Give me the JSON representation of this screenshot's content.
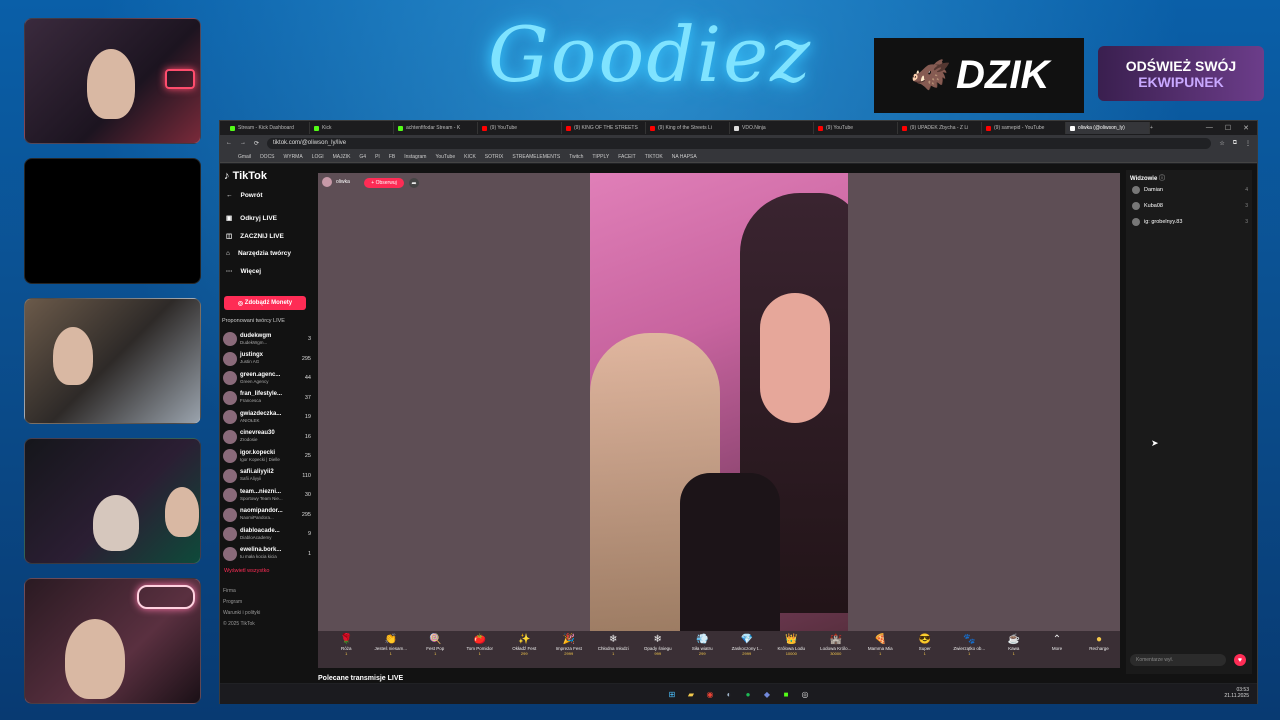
{
  "overlay": {
    "logo": "Goodiez",
    "sponsor_brand": "DZIK",
    "sponsor_promo_line1": "ODŚWIEŻ SWÓJ",
    "sponsor_promo_line2": "EKWIPUNEK"
  },
  "browser": {
    "tabs": [
      {
        "label": "Stream - Kick Dashboard",
        "color": "#53fc18"
      },
      {
        "label": "Kick",
        "color": "#53fc18"
      },
      {
        "label": "achtenfifodar Stream - K",
        "color": "#53fc18"
      },
      {
        "label": "(9) YouTube",
        "color": "#ff0000"
      },
      {
        "label": "(9) KING OF THE STREETS",
        "color": "#ff0000"
      },
      {
        "label": "(9) King of the Streets Li",
        "color": "#ff0000"
      },
      {
        "label": "VDO.Ninja",
        "color": "#dddddd"
      },
      {
        "label": "(9) YouTube",
        "color": "#ff0000"
      },
      {
        "label": "(9) UPADEK Zbycha - Z Li",
        "color": "#ff0000"
      },
      {
        "label": "(9) samepid - YouTube",
        "color": "#ff0000"
      },
      {
        "label": "oliwka (@oliwson_ly)",
        "color": "#ffffff",
        "active": true
      }
    ],
    "url": "tiktok.com/@oliwson_ly/live",
    "bookmarks": [
      "Gmail",
      "DOCS",
      "WYRMA",
      "LOGI",
      "MAJZIK",
      "G4",
      "PI",
      "FB",
      "Instagram",
      "YouTube",
      "KICK",
      "SOTRIX",
      "STREAMELEMENTS",
      "Twitch",
      "TIPPLY",
      "FACEIT",
      "TIKTOK",
      "NA HAPSA"
    ]
  },
  "tiktok": {
    "logo": "TikTok",
    "nav": {
      "back": "Powrót",
      "discover_live": "Odkryj LIVE",
      "start_live": "ZACZNIJ LIVE",
      "creator_tools": "Narzędzia twórcy",
      "more": "Więcej",
      "get_coins": "Zdobądź Monety"
    },
    "suggested_title": "Proponowani twórcy LIVE",
    "creators": [
      {
        "name": "dudekwgm",
        "sub": "DudekWgm...",
        "count": "3"
      },
      {
        "name": "justingx",
        "sub": "Justin AG",
        "count": "295"
      },
      {
        "name": "green.agenc...",
        "sub": "Green Agency",
        "count": "44"
      },
      {
        "name": "fran_lifestyle...",
        "sub": "Francesca",
        "count": "37"
      },
      {
        "name": "gwiazdeczka...",
        "sub": "ANIOŁEK",
        "count": "19"
      },
      {
        "name": "cinevreau30",
        "sub": "Zrodosie",
        "count": "16"
      },
      {
        "name": "igor.kopecki",
        "sub": "Igor Kopecki | Dielle",
        "count": "25"
      },
      {
        "name": "safii.aliyyii2",
        "sub": "Safii Aliyyii",
        "count": "110"
      },
      {
        "name": "team...niezni...",
        "sub": "Sportowy Team Nie...",
        "count": "30"
      },
      {
        "name": "naomipandor...",
        "sub": "NaomiPandora...",
        "count": "295"
      },
      {
        "name": "diabloacade...",
        "sub": "DiabloAcademy",
        "count": "9"
      },
      {
        "name": "ewelina.bork...",
        "sub": "tu mała kocia kicia",
        "count": "1"
      }
    ],
    "show_all": "Wyświetl wszystko",
    "footer": [
      "Firma",
      "Program",
      "Warunki i polityki",
      "© 2025 TikTok"
    ],
    "streamer": "oliwka",
    "follow": "+ Obserwuj",
    "gifts": [
      {
        "name": "Róża",
        "price": "1",
        "icon": "🌹"
      },
      {
        "name": "Jesteś niesam...",
        "price": "1",
        "icon": "👏"
      },
      {
        "name": "Fest Pop",
        "price": "1",
        "icon": "🍭"
      },
      {
        "name": "Tom Pomidor",
        "price": "1",
        "icon": "🍅"
      },
      {
        "name": "Okładź Fest",
        "price": "299",
        "icon": "✨"
      },
      {
        "name": "Impreza Fest",
        "price": "2999",
        "icon": "🎉"
      },
      {
        "name": "Chłodna młodzi",
        "price": "1",
        "icon": "❄"
      },
      {
        "name": "Opady śniegu",
        "price": "999",
        "icon": "❄"
      },
      {
        "name": "Siła wiatru",
        "price": "299",
        "icon": "💨"
      },
      {
        "name": "Zaskoczony t...",
        "price": "2999",
        "icon": "💎"
      },
      {
        "name": "Królowa Lodu",
        "price": "10000",
        "icon": "👑"
      },
      {
        "name": "Lodowa Królo...",
        "price": "30000",
        "icon": "🏰"
      },
      {
        "name": "Mamma Mia",
        "price": "1",
        "icon": "🍕"
      },
      {
        "name": "Super",
        "price": "1",
        "icon": "😎"
      },
      {
        "name": "Zwierzątko ob...",
        "price": "1",
        "icon": "🐾"
      },
      {
        "name": "Kawa",
        "price": "1",
        "icon": "☕"
      }
    ],
    "more_label": "More",
    "recharge": "Recharge",
    "recommended": "Polecane transmisje LIVE",
    "viewers_title": "Widzowie",
    "viewers": [
      {
        "name": "Damian",
        "n": "4"
      },
      {
        "name": "Kuba08",
        "n": "3"
      },
      {
        "name": "ig: grobelnyy.83",
        "n": "3"
      }
    ],
    "comment_placeholder": "Komentarze wył."
  },
  "taskbar": {
    "time": "03:53",
    "date": "21.11.2025"
  }
}
